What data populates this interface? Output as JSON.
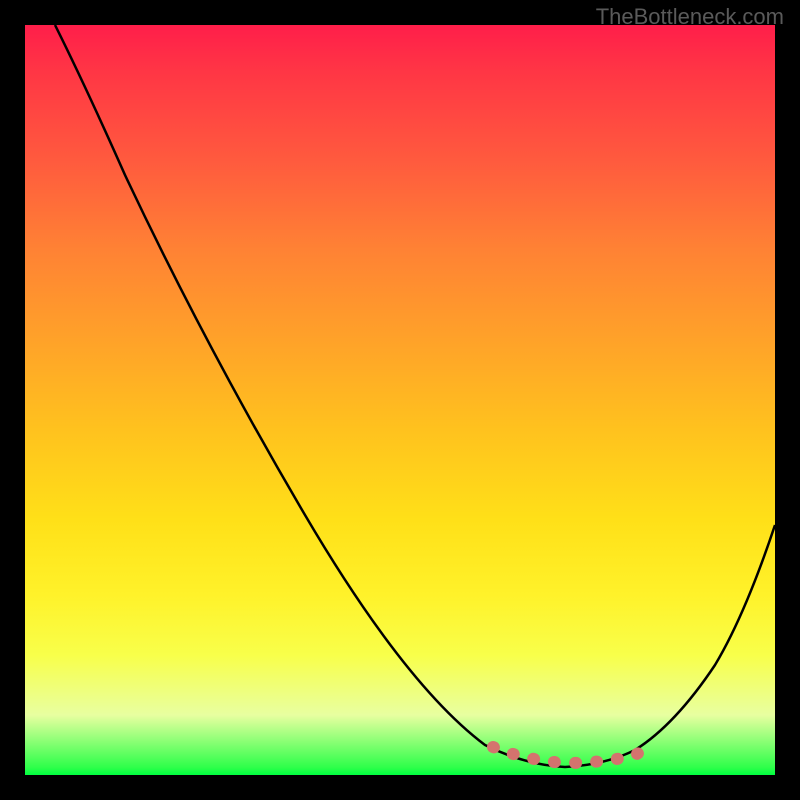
{
  "watermark": "TheBottleneck.com",
  "chart_data": {
    "type": "line",
    "title": "",
    "xlabel": "",
    "ylabel": "",
    "xlim": [
      0,
      100
    ],
    "ylim": [
      0,
      100
    ],
    "series": [
      {
        "name": "bottleneck-curve",
        "x": [
          4,
          10,
          20,
          30,
          40,
          50,
          60,
          65,
          68,
          70,
          72,
          74,
          76,
          78,
          80,
          82,
          85,
          90,
          95,
          100
        ],
        "y": [
          100,
          92,
          77,
          61,
          46,
          30,
          15,
          8,
          4,
          2,
          1,
          0.5,
          0.5,
          1,
          2,
          3,
          5,
          12,
          22,
          33
        ]
      },
      {
        "name": "optimal-zone-dots",
        "x": [
          63,
          66,
          68,
          70,
          72,
          74,
          76,
          78,
          80,
          82,
          84
        ],
        "y": [
          2.5,
          2,
          1.8,
          1.6,
          1.5,
          1.5,
          1.6,
          1.8,
          2,
          2.5,
          3.2
        ]
      }
    ],
    "colors": {
      "gradient_top": "#ff1e4a",
      "gradient_bottom": "#00ff40",
      "curve": "#000000",
      "dots": "#d4736e",
      "background": "#000000"
    }
  }
}
